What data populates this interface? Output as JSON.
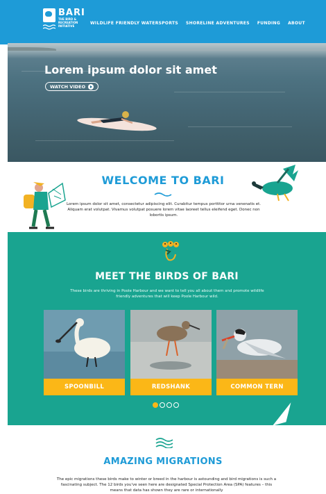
{
  "logo": {
    "title": "BARI",
    "subtitle": "THE BIRD & RECREATION INITIATIVE"
  },
  "nav": {
    "items": [
      "WILDLIFE FRIENDLY WATERSPORTS",
      "SHORELINE ADVENTURES",
      "FUNDING",
      "ABOUT"
    ]
  },
  "hero": {
    "title": "Lorem ipsum dolor sit amet",
    "button_label": "WATCH VIDEO"
  },
  "welcome": {
    "title": "WELCOME TO BARI",
    "text": "Lorem ipsum dolor sit amet, consectetur adipiscing elit. Curabitur tempus porttitor urna venenatis et. Aliquam erat volutpat. Vivamus volutpat posuere lorem vitae laoreet tellus eleifend eget. Donec non lobortis ipsum."
  },
  "birds": {
    "title": "MEET THE BIRDS OF BARI",
    "text": "These birds are thriving in Poole Harbour and we want to tell you all about them and promote wildlife friendly adventures that will keep Poole Harbour wild.",
    "cards": [
      {
        "label": "SPOONBILL"
      },
      {
        "label": "REDSHANK"
      },
      {
        "label": "COMMON TERN"
      }
    ],
    "carousel": {
      "current": 1,
      "total": 4
    }
  },
  "migrations": {
    "title": "AMAZING MIGRATIONS",
    "text": "The epic migrations these birds make to winter or breed in the harbour is astounding and bird migrations is such a fascinating subject. The 12 birds you've seen here are designated Special Protection Area (SPA) features – this means that data has shown they are rare or internationally"
  },
  "colors": {
    "header_blue": "#1e9bd7",
    "teal": "#19a490",
    "accent_yellow": "#fbb717",
    "heading_blue": "#1e9bd7"
  }
}
